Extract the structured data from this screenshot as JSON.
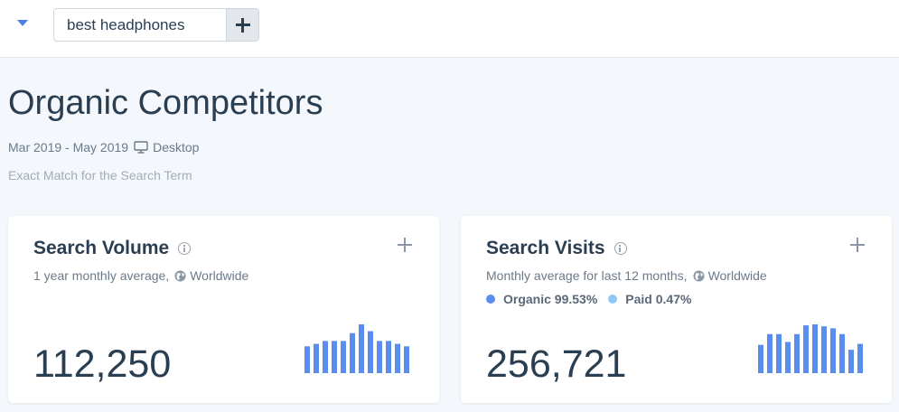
{
  "topbar": {
    "search": {
      "value": "best headphones"
    }
  },
  "page": {
    "title": "Organic Competitors",
    "date_range": "Mar 2019 - May 2019",
    "device": "Desktop",
    "subtitle": "Exact Match for the Search Term"
  },
  "cards": {
    "volume": {
      "title": "Search Volume",
      "sub_text": "1 year monthly average,",
      "region": "Worldwide",
      "value": "112,250",
      "sparkline": [
        0.55,
        0.6,
        0.66,
        0.66,
        0.66,
        0.82,
        1.0,
        0.86,
        0.66,
        0.66,
        0.6,
        0.55
      ]
    },
    "visits": {
      "title": "Search Visits",
      "sub_text": "Monthly average for last 12 months,",
      "region": "Worldwide",
      "legend": {
        "organic": "Organic 99.53%",
        "paid": "Paid 0.47%"
      },
      "value": "256,721",
      "sparkline": [
        0.58,
        0.8,
        0.8,
        0.64,
        0.8,
        0.98,
        1.0,
        0.96,
        0.92,
        0.8,
        0.48,
        0.6
      ]
    }
  },
  "colors": {
    "accent": "#5b8def",
    "organic": "#5b8def",
    "paid": "#8fc8f5",
    "text": "#2a3e52"
  }
}
